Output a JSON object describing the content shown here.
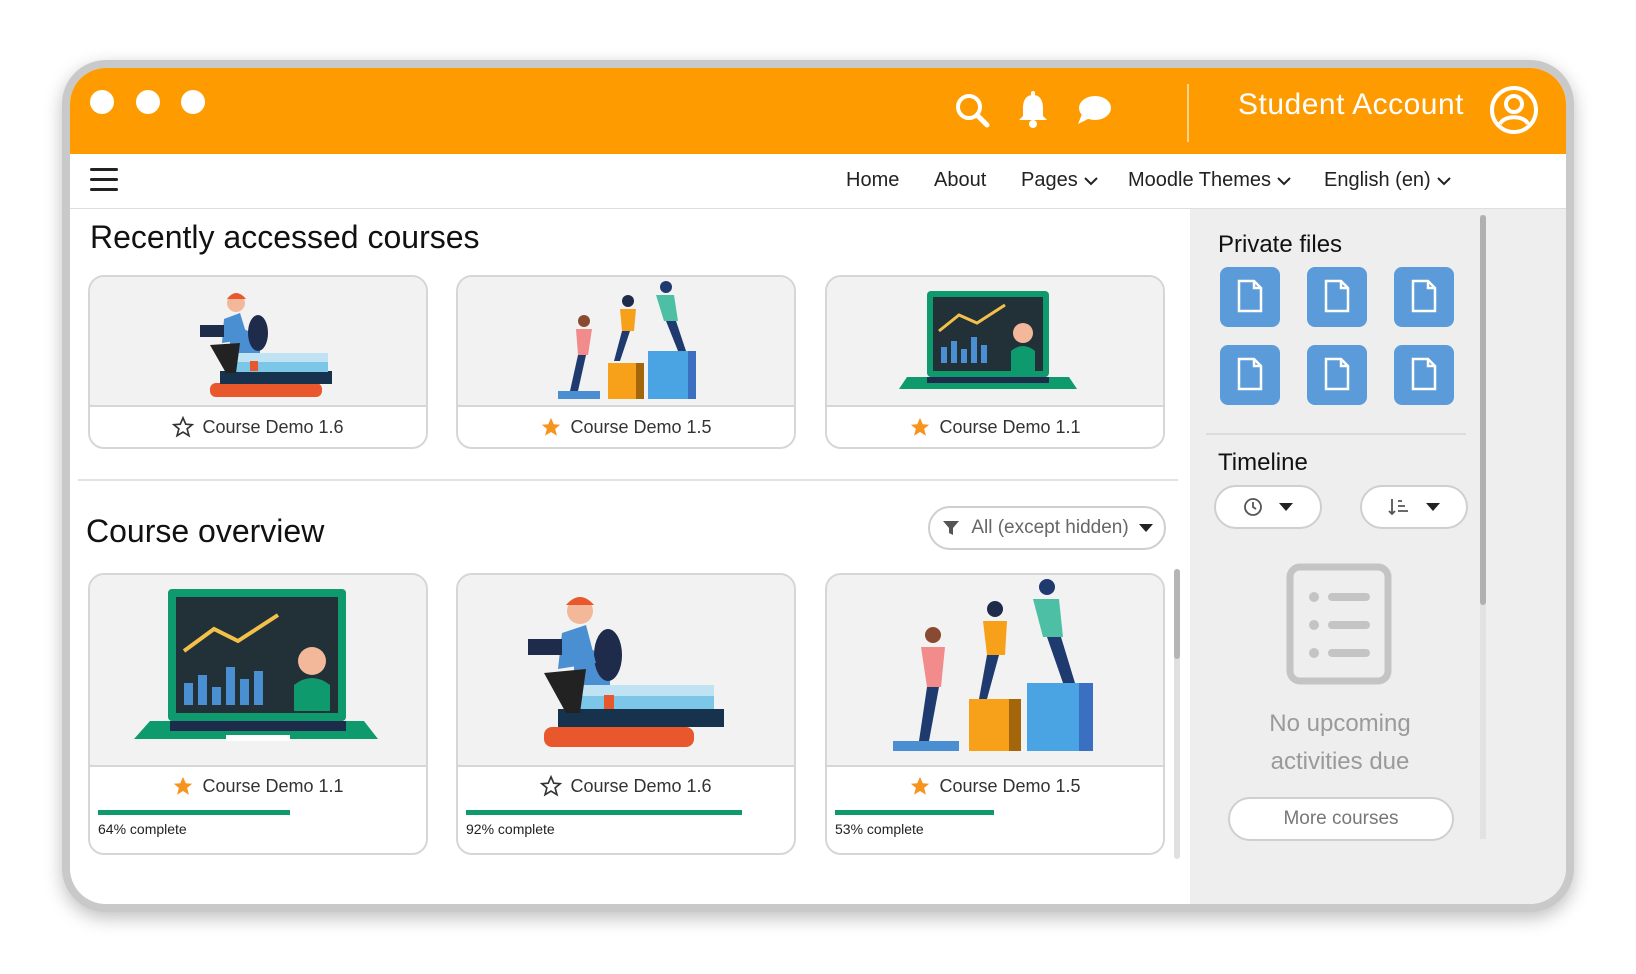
{
  "topbar": {
    "account_label": "Student Account",
    "icons": [
      "search-icon",
      "bell-icon",
      "chat-icon",
      "user-circle-icon"
    ],
    "color": "#fd9b00"
  },
  "nav": {
    "items": [
      "Home",
      "About",
      "Pages",
      "Moodle Themes",
      "English (en)"
    ]
  },
  "recent": {
    "title": "Recently accessed courses",
    "courses": [
      {
        "name": "Course Demo 1.6",
        "starred": false,
        "image": "reading-illustration"
      },
      {
        "name": "Course Demo 1.5",
        "starred": true,
        "image": "teamwork-illustration"
      },
      {
        "name": "Course Demo 1.1",
        "starred": true,
        "image": "laptop-illustration"
      }
    ]
  },
  "overview": {
    "title": "Course overview",
    "filter_label": "All (except hidden)",
    "courses": [
      {
        "name": "Course Demo 1.1",
        "starred": true,
        "progress": 0.64,
        "progress_label": "64% complete",
        "image": "laptop-illustration"
      },
      {
        "name": "Course Demo 1.6",
        "starred": false,
        "progress": 0.92,
        "progress_label": "92% complete",
        "image": "reading-illustration"
      },
      {
        "name": "Course Demo 1.5",
        "starred": true,
        "progress": 0.53,
        "progress_label": "53% complete",
        "image": "teamwork-illustration"
      }
    ]
  },
  "sidebar": {
    "private_files_title": "Private files",
    "timeline_title": "Timeline",
    "no_upcoming": "No upcoming activities due",
    "more_courses": "More courses"
  },
  "colors": {
    "accent": "#fd9b00",
    "star": "#f7941d",
    "progress": "#0f9a6e",
    "file": "#5b9bd9"
  }
}
